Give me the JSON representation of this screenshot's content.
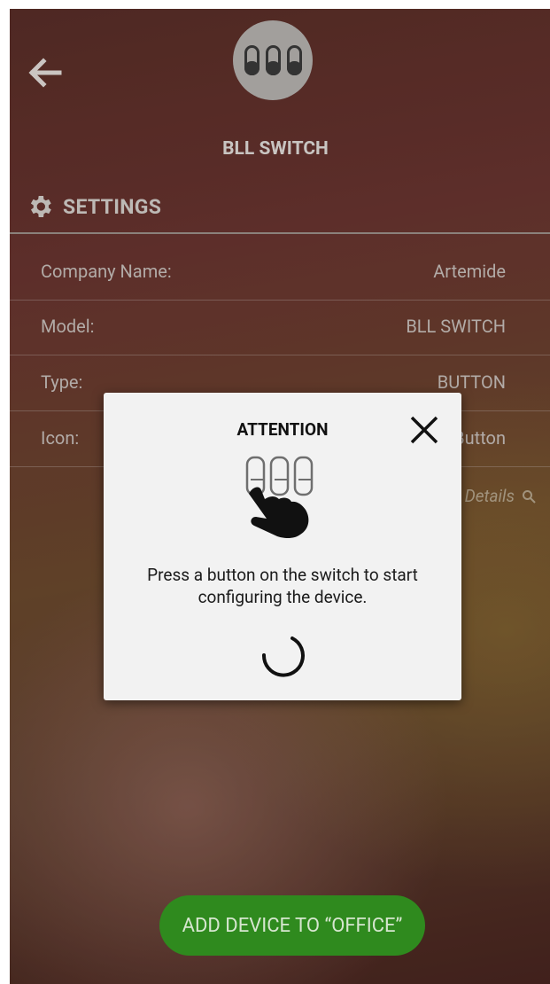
{
  "header": {
    "device_name": "BLL SWITCH",
    "back_icon": "arrow-left-icon",
    "device_icon": "three-button-switch-icon"
  },
  "settings": {
    "title": "SETTINGS",
    "icon": "gear-icon",
    "rows": [
      {
        "label": "Company Name:",
        "value": "Artemide"
      },
      {
        "label": "Model:",
        "value": "BLL SWITCH"
      },
      {
        "label": "Type:",
        "value": "BUTTON"
      },
      {
        "label": "Icon:",
        "value": "Button"
      }
    ],
    "details_link": "Details"
  },
  "footer": {
    "add_button_label": "ADD DEVICE TO “OFFICE”"
  },
  "dialog": {
    "title": "ATTENTION",
    "message": "Press a button on the switch to start configuring the device.",
    "close_icon": "close-icon",
    "illustration": "hand-pressing-switch-icon",
    "loading_icon": "spinner-icon"
  },
  "colors": {
    "add_button": "#2f8a1e",
    "dialog_bg": "#f2f2f2"
  }
}
